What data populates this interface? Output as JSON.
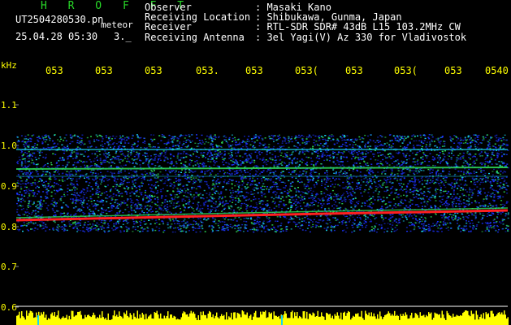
{
  "header": {
    "brand": "H R O F F T",
    "filename": "UT2504280530.pn",
    "filetype": "meteor",
    "date_time": "25.04.28 05:30",
    "duration": "3._"
  },
  "station": [
    {
      "label": "Observer",
      "value": ": Masaki Kano"
    },
    {
      "label": "Receiving Location",
      "value": ": Shibukawa, Gunma, Japan"
    },
    {
      "label": "Receiver",
      "value": ": RTL-SDR SDR# 43dB L15 103.2MHz CW"
    },
    {
      "label": "Receiving Antenna",
      "value": ": 3el Yagi(V) Az 330 for Vladivostok"
    }
  ],
  "axis": {
    "y_unit": "kHz",
    "y_ticks": [
      "1.1",
      "1.0",
      "0.9",
      "0.8",
      "0.7",
      "0.6"
    ],
    "time_ticks": [
      "053",
      "053",
      "053",
      "053.",
      "053",
      "053(",
      "053",
      "053(",
      "053",
      "0540"
    ]
  },
  "colors": {
    "background": "#000000",
    "axis_text": "#ffff00",
    "brand": "#28d828",
    "activity": "#ffff00",
    "signal": "#ff2020",
    "noise_blue": "#1c34ff",
    "noise_cyan": "#19d6f0",
    "noise_green": "#2fe05a"
  }
}
